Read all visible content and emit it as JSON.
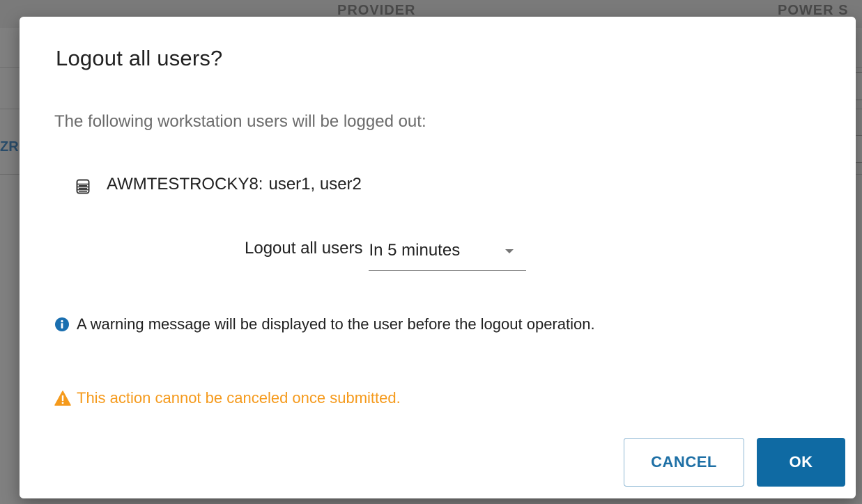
{
  "background": {
    "column_provider": "PROVIDER",
    "column_power": "POWER S",
    "row_fragment": "ZR"
  },
  "dialog": {
    "title": "Logout all users?",
    "description": "The following workstation users will be logged out:",
    "workstation": {
      "icon": "server-icon",
      "name": "AWMTESTROCKY8:",
      "users": "user1, user2"
    },
    "schedule": {
      "label": "Logout all users",
      "selected_option": "In 5 minutes"
    },
    "info": {
      "icon": "info-icon",
      "text": "A warning message will be displayed to the user before the logout operation."
    },
    "warning": {
      "icon": "warning-icon",
      "text": "This action cannot be canceled once submitted."
    },
    "buttons": {
      "cancel_label": "CANCEL",
      "ok_label": "OK"
    }
  },
  "colors": {
    "primary": "#0f6aa3",
    "info": "#1a6fb0",
    "warning": "#f59a1c"
  }
}
